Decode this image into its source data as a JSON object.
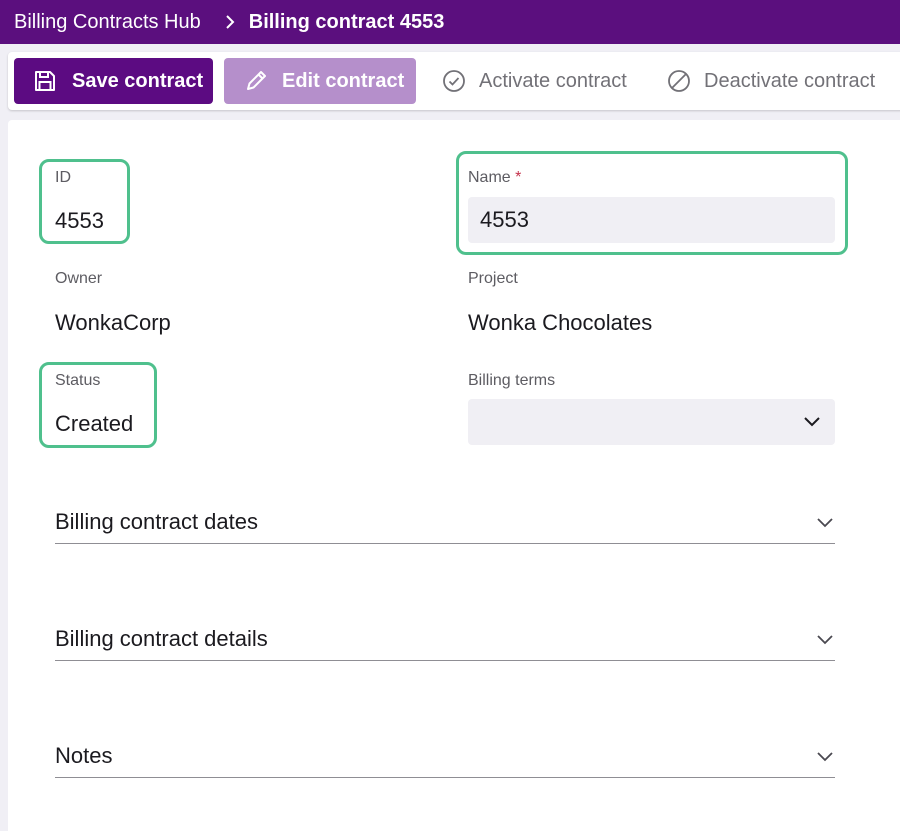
{
  "breadcrumb": {
    "root": "Billing Contracts Hub",
    "current": "Billing contract 4553"
  },
  "toolbar": {
    "save_label": "Save contract",
    "edit_label": "Edit contract",
    "activate_label": "Activate contract",
    "deactivate_label": "Deactivate contract"
  },
  "form": {
    "id": {
      "label": "ID",
      "value": "4553"
    },
    "name": {
      "label": "Name",
      "required_marker": "*",
      "value": "4553"
    },
    "owner": {
      "label": "Owner",
      "value": "WonkaCorp"
    },
    "project": {
      "label": "Project",
      "value": "Wonka Chocolates"
    },
    "status": {
      "label": "Status",
      "value": "Created"
    },
    "billing_terms": {
      "label": "Billing terms",
      "value": ""
    }
  },
  "sections": [
    {
      "title": "Billing contract dates"
    },
    {
      "title": "Billing contract details"
    },
    {
      "title": "Notes"
    }
  ],
  "colors": {
    "header_bg": "#5b0f7e",
    "primary_button": "#5c0b82",
    "disabled_button": "#b58fcb",
    "highlight": "#4fc08d",
    "required": "#c4314b"
  },
  "icons": {
    "breadcrumb_separator": "chevron-right-icon",
    "save": "save-icon",
    "edit": "pencil-icon",
    "activate": "check-circle-icon",
    "deactivate": "prohibited-icon",
    "section_toggle": "chevron-down-icon"
  }
}
